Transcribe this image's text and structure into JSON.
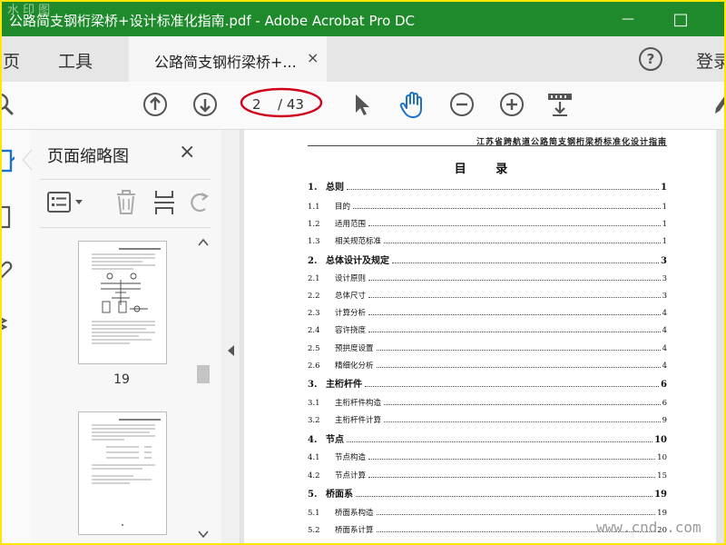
{
  "app": {
    "title": "公路简支钢桁梁桥+设计标准化指南.pdf - Adobe Acrobat Pro DC",
    "corner_watermark": "水 印 图",
    "minimize_glyph": "—",
    "maximize_glyph": "□"
  },
  "tabs": {
    "home": "主页",
    "tools": "工具",
    "document": "公路简支钢桁梁桥+...",
    "close_glyph": "×",
    "help_glyph": "?",
    "login": "登录"
  },
  "toolbar": {
    "page_current": "2",
    "page_total": "/ 43"
  },
  "thumbnails": {
    "title": "页面缩略图",
    "close_glyph": "×",
    "items": [
      {
        "page_number": "19"
      },
      {
        "page_number": ""
      }
    ]
  },
  "document": {
    "header": "江苏省跨航道公路简支钢桁梁桥标准化设计指南",
    "toc_title": "目 录",
    "entries": [
      {
        "num": "1.",
        "text": "总则",
        "page": "1",
        "level": "chapter"
      },
      {
        "num": "1.1",
        "text": "目的",
        "page": "1",
        "level": "section"
      },
      {
        "num": "1.2",
        "text": "适用范围",
        "page": "1",
        "level": "section"
      },
      {
        "num": "1.3",
        "text": "相关规范标准",
        "page": "1",
        "level": "section"
      },
      {
        "num": "2.",
        "text": "总体设计及规定",
        "page": "3",
        "level": "chapter"
      },
      {
        "num": "2.1",
        "text": "设计原则",
        "page": "3",
        "level": "section"
      },
      {
        "num": "2.2",
        "text": "总体尺寸",
        "page": "3",
        "level": "section"
      },
      {
        "num": "2.3",
        "text": "计算分析",
        "page": "4",
        "level": "section"
      },
      {
        "num": "2.4",
        "text": "容许挠度",
        "page": "4",
        "level": "section"
      },
      {
        "num": "2.5",
        "text": "预拱度设置",
        "page": "4",
        "level": "section"
      },
      {
        "num": "2.6",
        "text": "精细化分析",
        "page": "4",
        "level": "section"
      },
      {
        "num": "3.",
        "text": "主桁杆件",
        "page": "6",
        "level": "chapter"
      },
      {
        "num": "3.1",
        "text": "主桁杆件构造",
        "page": "6",
        "level": "section"
      },
      {
        "num": "3.2",
        "text": "主桁杆件计算",
        "page": "9",
        "level": "section"
      },
      {
        "num": "4.",
        "text": "节点",
        "page": "10",
        "level": "chapter"
      },
      {
        "num": "4.1",
        "text": "节点构造",
        "page": "10",
        "level": "section"
      },
      {
        "num": "4.2",
        "text": "节点计算",
        "page": "15",
        "level": "section"
      },
      {
        "num": "5.",
        "text": "桥面系",
        "page": "19",
        "level": "chapter"
      },
      {
        "num": "5.1",
        "text": "桥面系构造",
        "page": "19",
        "level": "section"
      },
      {
        "num": "5.2",
        "text": "桥面系计算",
        "page": "20",
        "level": "section"
      }
    ]
  },
  "site_watermark": "www.cnd  .com",
  "colors": {
    "title_bar": "#1f8a2b",
    "accent_blue": "#1a73c9",
    "annotation_red": "#d0021b",
    "screenshot_border": "#ffe600"
  }
}
